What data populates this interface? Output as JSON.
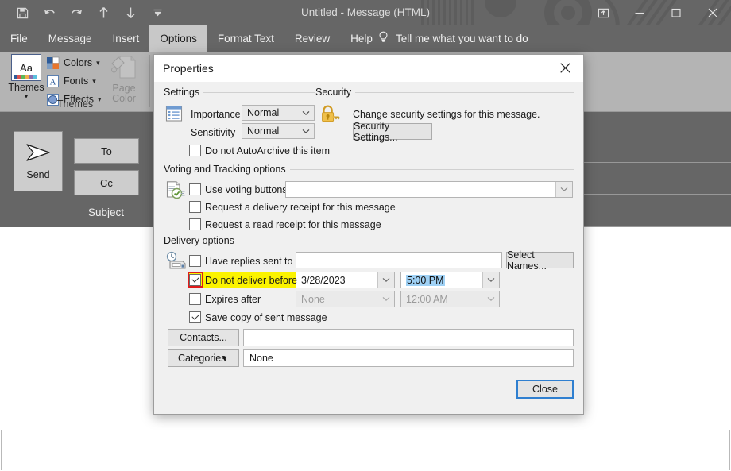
{
  "window": {
    "title": "Untitled  -  Message (HTML)",
    "quick_access": [
      {
        "name": "save-icon",
        "label": "Save"
      },
      {
        "name": "undo-icon",
        "label": "Undo"
      },
      {
        "name": "redo-icon",
        "label": "Redo"
      },
      {
        "name": "previous-item-icon",
        "label": "Previous Item"
      },
      {
        "name": "next-item-icon",
        "label": "Next Item"
      },
      {
        "name": "customize-quick-access-toolbar-icon",
        "label": "Customize Quick Access Toolbar"
      }
    ],
    "controls": [
      {
        "name": "ribbon-display-options",
        "label": "Ribbon Display Options"
      },
      {
        "name": "minimize",
        "label": "Minimize"
      },
      {
        "name": "maximize",
        "label": "Maximize"
      },
      {
        "name": "close",
        "label": "Close"
      }
    ]
  },
  "ribbon": {
    "tabs": [
      {
        "label": "File",
        "active": false
      },
      {
        "label": "Message",
        "active": false
      },
      {
        "label": "Insert",
        "active": false
      },
      {
        "label": "Options",
        "active": true
      },
      {
        "label": "Format Text",
        "active": false
      },
      {
        "label": "Review",
        "active": false
      },
      {
        "label": "Help",
        "active": false
      }
    ],
    "tell_me": "Tell me what you want to do",
    "themes_group": {
      "group_label": "Themes",
      "themes_button": "Themes",
      "themes_tile_text": "Aa",
      "commands": [
        {
          "label": "Colors"
        },
        {
          "label": "Fonts"
        },
        {
          "label": "Effects"
        }
      ],
      "page_color": "Page Color"
    }
  },
  "compose": {
    "send_button": "Send",
    "to_button": "To",
    "cc_button": "Cc",
    "subject_label": "Subject"
  },
  "dialog": {
    "title": "Properties",
    "close_icon_label": "Close",
    "settings": {
      "group_label": "Settings",
      "importance_label": "Importance",
      "importance_value": "Normal",
      "sensitivity_label": "Sensitivity",
      "sensitivity_value": "Normal",
      "autoarchive_label": "Do not AutoArchive this item",
      "autoarchive_checked": false
    },
    "security": {
      "group_label": "Security",
      "description": "Change security settings for this message.",
      "settings_button": "Security Settings..."
    },
    "voting": {
      "group_label": "Voting and Tracking options",
      "use_voting_label": "Use voting buttons",
      "use_voting_checked": false,
      "voting_value": "",
      "delivery_receipt_label": "Request a delivery receipt for this message",
      "delivery_receipt_checked": false,
      "read_receipt_label": "Request a read receipt for this message",
      "read_receipt_checked": false
    },
    "delivery": {
      "group_label": "Delivery options",
      "have_replies_label": "Have replies sent to",
      "have_replies_checked": false,
      "have_replies_value": "",
      "select_names_button": "Select Names...",
      "do_not_deliver_label": "Do not deliver before",
      "do_not_deliver_checked": true,
      "do_not_deliver_date": "3/28/2023",
      "do_not_deliver_time": "5:00 PM",
      "expires_after_label": "Expires after",
      "expires_after_checked": false,
      "expires_after_date": "None",
      "expires_after_time": "12:00 AM",
      "save_copy_label": "Save copy of sent message",
      "save_copy_checked": true
    },
    "footer": {
      "contacts_button": "Contacts...",
      "contacts_value": "",
      "categories_button": "Categories",
      "categories_value": "None",
      "close_button": "Close"
    }
  },
  "colors": {
    "chrome": "#666666",
    "ribbon": "#b4b4b4",
    "dialog_bg": "#f0f0f0",
    "accent": "#2f7fd0",
    "highlight": "#fbf300",
    "annotation": "#e01b1b",
    "selection": "#9fd1f5"
  }
}
